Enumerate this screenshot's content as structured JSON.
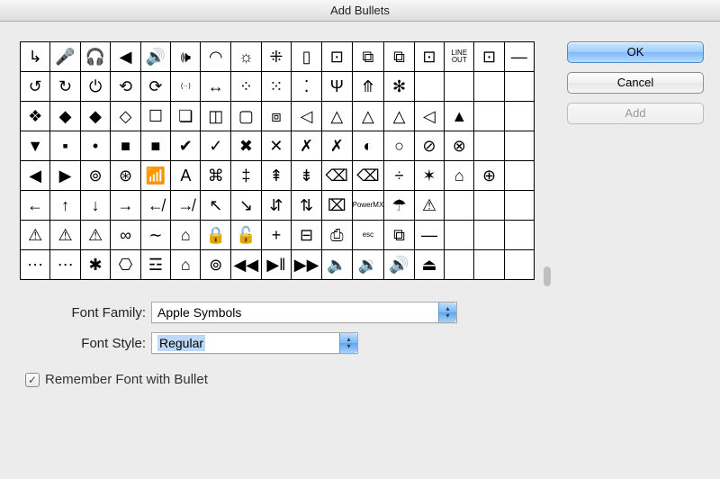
{
  "window": {
    "title": "Add Bullets"
  },
  "buttons": {
    "ok": "OK",
    "cancel": "Cancel",
    "add": "Add"
  },
  "symbols": {
    "rows": [
      [
        "↳",
        "🎤",
        "🎧",
        "◀",
        "🔊",
        "🕪",
        "◠",
        "☼",
        "⁜",
        "▯",
        "⊡",
        "⧉",
        "⧉",
        "⊡",
        "LINE OUT",
        "⊡",
        "—"
      ],
      [
        "↺",
        "↻",
        "⏻",
        "⟲",
        "⟳",
        "⟨··⟩",
        "↔",
        "⁘",
        "⁙",
        "⁚",
        "Ψ",
        "⤊",
        "✻",
        "",
        "",
        ""
      ],
      [
        "❖",
        "◆",
        "◆",
        "◇",
        "☐",
        "❏",
        "◫",
        "▢",
        "⧈",
        "◁",
        "△",
        "△",
        "△",
        "◁",
        "▲",
        ""
      ],
      [
        "▼",
        "▪",
        "•",
        "■",
        "■",
        "✔",
        "✓",
        "✖",
        "✕",
        "✗",
        "✗",
        "◐",
        "○",
        "⊘",
        "⊗",
        ""
      ],
      [
        "◀",
        "▶",
        "⊚",
        "⊛",
        "📶",
        "A",
        "⌘",
        "‡",
        "⇞",
        "⇟",
        "⌫",
        "⌫",
        "÷",
        "✶",
        "⌂",
        "⊕"
      ],
      [
        "←",
        "↑",
        "↓",
        "→",
        "↚",
        "↛",
        "↖",
        "↘",
        "⇵",
        "⇅",
        "⌧",
        "PowerMX",
        "☂",
        "⚠",
        "",
        ""
      ],
      [
        "⚠",
        "⚠",
        "⚠",
        "∞",
        "∼",
        "⌂",
        "🔒",
        "🔓",
        "+",
        "⊟",
        "⎙",
        "esc",
        "⧉",
        "—",
        "",
        ""
      ],
      [
        "⋯",
        "⋯",
        "✱",
        "⎔",
        "☲",
        "⌂",
        "⊚",
        "◀◀",
        "▶‖",
        "▶▶",
        "🔈",
        "🔉",
        "🔊",
        "⏏",
        "",
        ""
      ]
    ]
  },
  "form": {
    "font_family_label": "Font Family:",
    "font_family_value": "Apple Symbols",
    "font_style_label": "Font Style:",
    "font_style_value": "Regular"
  },
  "checkbox": {
    "remember_label": "Remember Font with Bullet",
    "checked": true
  },
  "icons": {
    "check": "✓",
    "arrow_up": "▴",
    "arrow_down": "▾"
  }
}
